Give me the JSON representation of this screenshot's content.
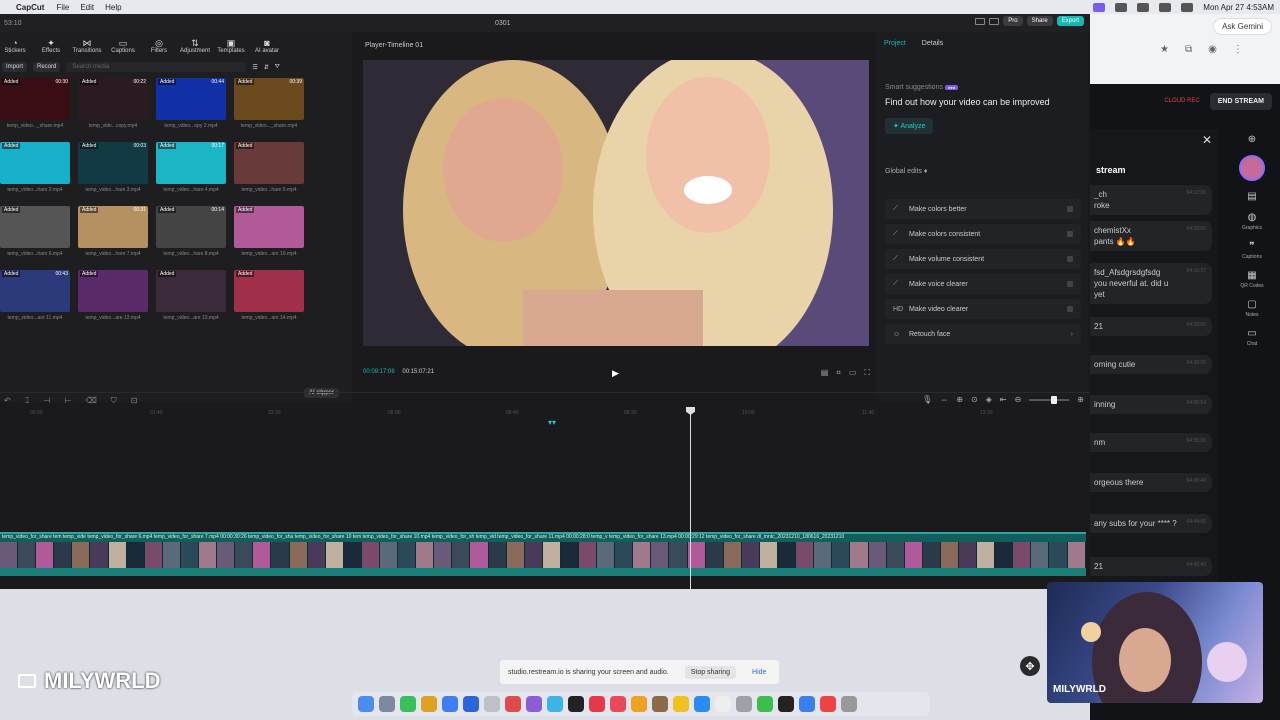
{
  "menubar": {
    "app": "CapCut",
    "items": [
      "File",
      "Edit",
      "Help"
    ],
    "datetime": "Mon Apr 27  4:53AM"
  },
  "capcut": {
    "window_title": "0301",
    "title_left": "53:10",
    "pro_label": "Pro",
    "share_label": "Share",
    "export_label": "Export",
    "toolbar": [
      "Stickers",
      "Effects",
      "Transitions",
      "Captions",
      "Filters",
      "Adjustment",
      "Templates",
      "AI avatar"
    ],
    "import_label": "Import",
    "record_label": "Record",
    "search_placeholder": "Search media",
    "ai_clipper": "AI clipper",
    "media": [
      {
        "added": "Added",
        "dur": "00:30",
        "name": "temp_video..._share.mp4",
        "color": "#3a0d14"
      },
      {
        "added": "Added",
        "dur": "00:22",
        "name": "temp_vide...copy.mp4",
        "color": "#2b1a22"
      },
      {
        "added": "Added",
        "dur": "00:44",
        "name": "temp_video...opy 2.mp4",
        "color": "#1230a8"
      },
      {
        "added": "Added",
        "dur": "00:39",
        "name": "temp_video..._share.mp4",
        "color": "#6a4a1c"
      },
      {
        "added": "Added",
        "dur": "",
        "name": "temp_video...hare 2.mp4",
        "color": "#16b0c8"
      },
      {
        "added": "Added",
        "dur": "00:03",
        "name": "temp_video...hare 3.mp4",
        "color": "#123a44"
      },
      {
        "added": "Added",
        "dur": "00:17",
        "name": "temp_video...hare 4.mp4",
        "color": "#1bb6c6"
      },
      {
        "added": "Added",
        "dur": "",
        "name": "temp_video...hare 5.mp4",
        "color": "#6a3a3a"
      },
      {
        "added": "Added",
        "dur": "",
        "name": "temp_video...hare 6.mp4",
        "color": "#555"
      },
      {
        "added": "Added",
        "dur": "00:31",
        "name": "temp_video...hare 7.mp4",
        "color": "#b59060"
      },
      {
        "added": "Added",
        "dur": "00:14",
        "name": "temp_video...hare 8.mp4",
        "color": "#444"
      },
      {
        "added": "Added",
        "dur": "",
        "name": "temp_video...are 10.mp4",
        "color": "#b05a9a"
      },
      {
        "added": "Added",
        "dur": "00:43",
        "name": "temp_video...are 11.mp4",
        "color": "#2a3a7a"
      },
      {
        "added": "Added",
        "dur": "",
        "name": "temp_video...are 12.mp4",
        "color": "#5a2a6a"
      },
      {
        "added": "Added",
        "dur": "",
        "name": "temp_video...are 13.mp4",
        "color": "#3a2a3a"
      },
      {
        "added": "Added",
        "dur": "",
        "name": "temp_video...are 14.mp4",
        "color": "#a0304a"
      }
    ],
    "player": {
      "title": "Player-Timeline 01",
      "current_time": "00:09:17:08",
      "total_time": "00:15:07:21"
    },
    "right_panel": {
      "tab_project": "Project",
      "tab_details": "Details",
      "smart_suggestions": "Smart suggestions",
      "improve_text": "Find out how your video can be improved",
      "analyze": "Analyze",
      "global_edits": "Global edits",
      "edits": [
        {
          "icon": "wand",
          "label": "Make colors better"
        },
        {
          "icon": "wand",
          "label": "Make colors consistent"
        },
        {
          "icon": "wand",
          "label": "Make volume consistent"
        },
        {
          "icon": "wand",
          "label": "Make voice clearer"
        },
        {
          "icon": "HD",
          "label": "Make video clearer"
        },
        {
          "icon": "face",
          "label": "Retouch face"
        }
      ]
    },
    "timeline": {
      "clip_labels": "temp_video_for_share  tem  temp_vide  temp_video_for_share 6.mp4  temp_video_for_share 7.mp4  00:00:30:26  temp_video_for_sha  temp_video_for_share 10  tem  temp_video_for_share 10.mp4  temp_video_for_sh  temp_vid  temp_video_for_share 11.mp4  00:00:28:0  temp_v  temp_video_for_share 13.mp4  00:00:29:12  temp_video_for_share  dl_mntc_20231210_180616_20231210"
    }
  },
  "browser": {
    "gemini": "Ask Gemini",
    "cloud_rec": "CLOUD REC",
    "end_stream": "END STREAM",
    "chat_title": "stream",
    "messages": [
      {
        "text": "_ch\nroke",
        "time": "04:12:00"
      },
      {
        "text": "chemistXx\npants 🔥🔥",
        "time": "04:20:00"
      },
      {
        "text": "fsd_Afsdgrsdgfsdg\nyou neverful at. did u\nyet",
        "time": "04:16:37"
      },
      {
        "text": "21",
        "time": "04:20:00"
      },
      {
        "text": "orning cutie",
        "time": "04:30:00"
      },
      {
        "text": "inning",
        "time": "04:55:54"
      },
      {
        "text": "nm",
        "time": "04:55:00"
      },
      {
        "text": "orgeous there",
        "time": "04:45:40"
      },
      {
        "text": "any subs for your **** ?",
        "time": "04:44:00"
      },
      {
        "text": "21",
        "time": "04:45:40"
      }
    ],
    "rail": [
      "Graphics",
      "Captions",
      "QR Codes",
      "Notes",
      "Chat"
    ]
  },
  "overlay": {
    "watermark": "MILYWRLD",
    "share_text": "studio.restream.io is sharing your screen and audio.",
    "stop_sharing": "Stop sharing",
    "hide": "Hide",
    "webcam_name": "MILYWRLD"
  },
  "dock_colors": [
    "#4a8cf0",
    "#7b8aa0",
    "#35c05a",
    "#e0a020",
    "#3d7ef0",
    "#2a66d8",
    "#c0c0c8",
    "#e04a4a",
    "#8a5cd8",
    "#3cb4e8",
    "#222",
    "#e23a4a",
    "#e84a5a",
    "#f0a020",
    "#8a6a4a",
    "#f4c020",
    "#2a8cf0",
    "#eee",
    "#a0a0a8",
    "#3ac04a",
    "#222",
    "#3a7ef0",
    "#e44",
    "#999"
  ]
}
